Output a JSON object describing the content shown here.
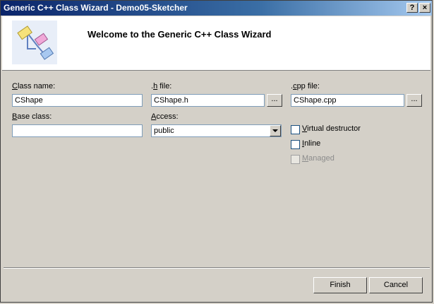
{
  "window": {
    "title": "Generic C++ Class Wizard - Demo05-Sketcher",
    "help_glyph": "?",
    "close_glyph": "×"
  },
  "header": {
    "title": "Welcome to the Generic C++ Class Wizard",
    "icon": "class-diagram-icon"
  },
  "form": {
    "class_name": {
      "label_key": "C",
      "label_rest": "lass name:",
      "value": "CShape"
    },
    "h_file": {
      "label_pre": ".",
      "label_key": "h",
      "label_rest": " file:",
      "value": "CShape.h",
      "browse": "..."
    },
    "cpp_file": {
      "label_pre": ".",
      "label_key": "c",
      "label_rest": "pp file:",
      "value": "CShape.cpp",
      "browse": "..."
    },
    "base_class": {
      "label_key": "B",
      "label_rest": "ase class:",
      "value": ""
    },
    "access": {
      "label_key": "A",
      "label_rest": "ccess:",
      "value": "public"
    },
    "virtual_destructor": {
      "label_key": "V",
      "label_rest": "irtual destructor",
      "checked": false
    },
    "inline": {
      "label_key": "I",
      "label_rest": "nline",
      "checked": false
    },
    "managed": {
      "label_key": "M",
      "label_rest": "anaged",
      "checked": false,
      "disabled": true
    }
  },
  "buttons": {
    "finish": "Finish",
    "cancel": "Cancel"
  }
}
